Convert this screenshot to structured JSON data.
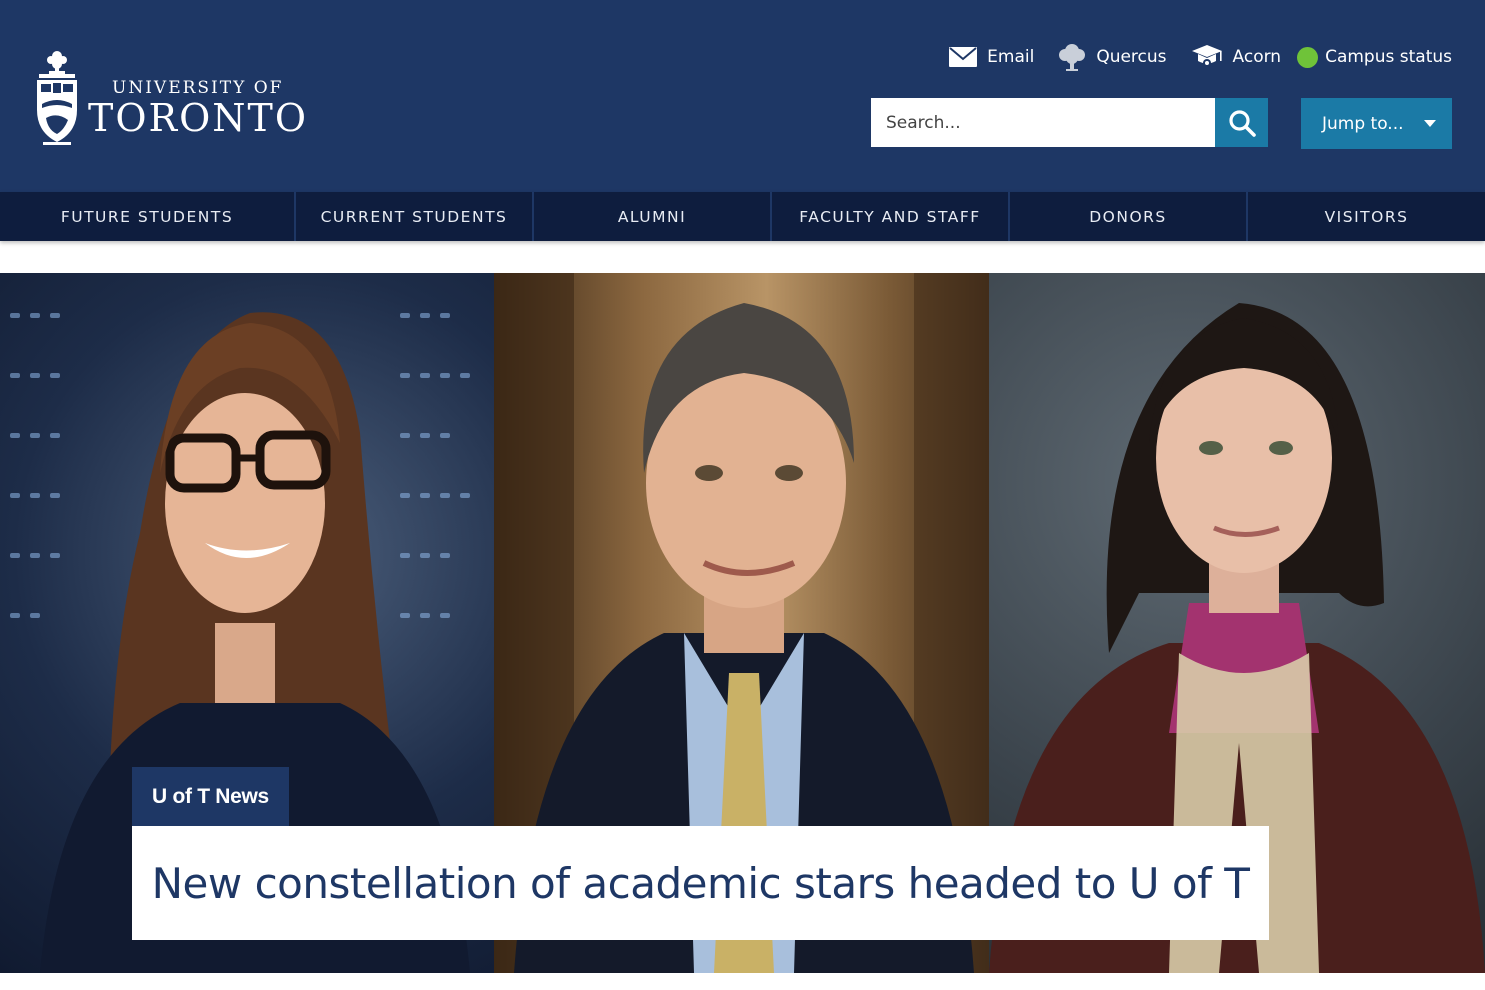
{
  "brand": {
    "line1": "UNIVERSITY OF",
    "line2": "TORONTO"
  },
  "top_links": [
    {
      "label": "Email",
      "icon": "envelope-icon"
    },
    {
      "label": "Quercus",
      "icon": "tree-icon"
    },
    {
      "label": "Acorn",
      "icon": "graduation-cap-icon"
    },
    {
      "label": "Campus status",
      "icon": "status-dot",
      "status_color": "#6fc339"
    }
  ],
  "search": {
    "placeholder": "Search..."
  },
  "jump": {
    "label": "Jump to..."
  },
  "nav": [
    "FUTURE STUDENTS",
    "CURRENT STUDENTS",
    "ALUMNI",
    "FACULTY AND STAFF",
    "DONORS",
    "VISITORS"
  ],
  "hero": {
    "tag": "U of T News",
    "headline": "New constellation of academic stars headed to U of T"
  },
  "colors": {
    "header": "#1e3765",
    "nav": "#0e1d3e",
    "accent": "#1b7aa6"
  }
}
